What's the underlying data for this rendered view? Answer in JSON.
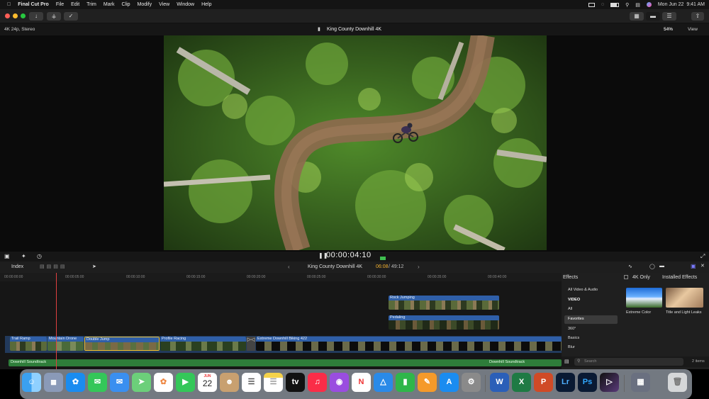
{
  "menubar": {
    "app": "Final Cut Pro",
    "items": [
      "File",
      "Edit",
      "Trim",
      "Mark",
      "Clip",
      "Modify",
      "View",
      "Window",
      "Help"
    ],
    "datetime": "Mon Jun 22  9:41 AM"
  },
  "viewer": {
    "format": "4K 24p, Stereo",
    "title": "King County Downhill 4K",
    "zoom": "54%",
    "view_label": "View",
    "timecode": "00:00:04:10"
  },
  "timeline": {
    "index_label": "Index",
    "project": "King County Downhill 4K",
    "position": "06:08",
    "duration": "/ 49:12",
    "ruler": [
      "00:00:00:00",
      "00:00:05:00",
      "00:00:10:00",
      "00:00:15:00",
      "00:00:20:00",
      "00:00:25:00",
      "00:00:30:00",
      "00:00:35:00",
      "00:00:40:00"
    ],
    "clips": {
      "rock_jumping": "Rock Jumping",
      "pedaling": "Pedaling",
      "trail_ramp": "Trail Ramp",
      "mountain_drone": "Mountain Drone",
      "double_jump": "Double Jump",
      "profile_racing": "Profile Racing",
      "extreme": "Extreme Downhill Biking 422",
      "soundtrack1": "Downhill Soundtrack",
      "soundtrack2": "Downhill Soundtrack"
    }
  },
  "effects": {
    "title": "Effects",
    "filter": "4K Only",
    "installed": "Installed Effects",
    "categories": [
      "All Video & Audio",
      "VIDEO",
      "All",
      "Favorites",
      "360°",
      "Basics",
      "Blur"
    ],
    "selected": "Favorites",
    "items": [
      {
        "name": "Extreme Color"
      },
      {
        "name": "Title and Light Leaks"
      }
    ],
    "search_placeholder": "Search",
    "count": "2 items"
  },
  "dock": {
    "calendar_month": "JUN",
    "calendar_day": "22"
  }
}
